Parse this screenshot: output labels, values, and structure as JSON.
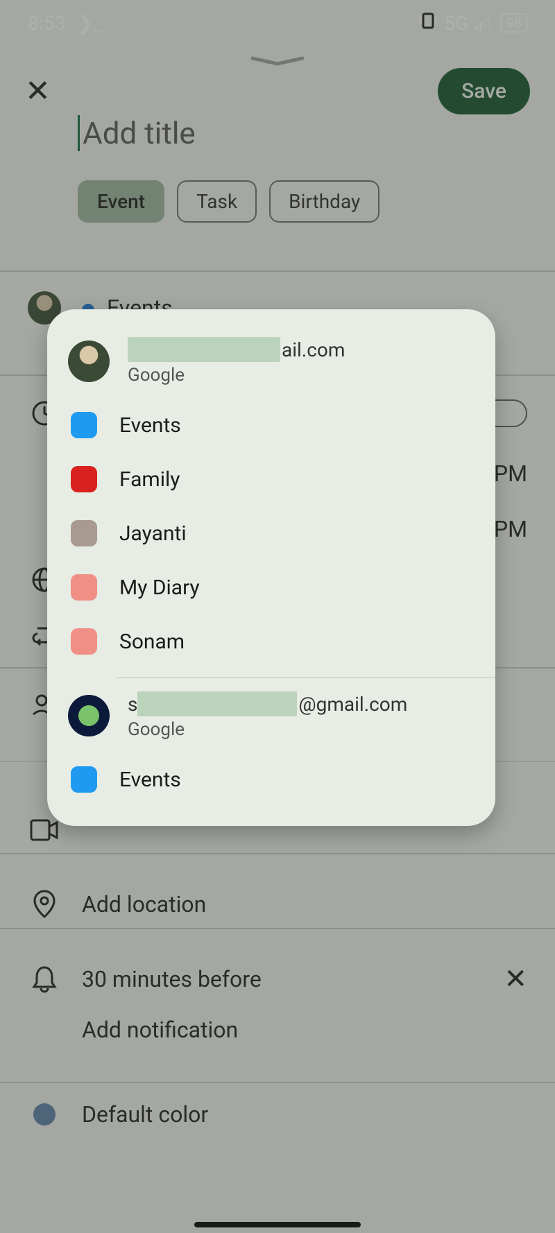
{
  "status": {
    "time": "8:53",
    "prompt_glyph": "❯_",
    "network": "5G",
    "battery": "98"
  },
  "header": {
    "save_label": "Save"
  },
  "title": {
    "placeholder": "Add title",
    "value": ""
  },
  "chips": {
    "event": "Event",
    "task": "Task",
    "birthday": "Birthday"
  },
  "calendar_row": {
    "label": "Events"
  },
  "time": {
    "suffix1": "PM",
    "suffix2": "PM"
  },
  "rows": {
    "location": "Add location",
    "notification": "30 minutes before",
    "add_notification": "Add notification",
    "default_color": "Default color"
  },
  "popover": {
    "accounts": [
      {
        "email_suffix": "ail.com",
        "provider": "Google",
        "calendars": [
          {
            "name": "Events",
            "color": "#1e9bf0"
          },
          {
            "name": "Family",
            "color": "#d92020"
          },
          {
            "name": "Jayanti",
            "color": "#a89a8f"
          },
          {
            "name": "My Diary",
            "color": "#f08f86"
          },
          {
            "name": "Sonam",
            "color": "#f08f86"
          }
        ]
      },
      {
        "email_prefix": "s",
        "email_suffix": "@gmail.com",
        "provider": "Google",
        "calendars": [
          {
            "name": "Events",
            "color": "#1e9bf0"
          }
        ]
      }
    ]
  }
}
